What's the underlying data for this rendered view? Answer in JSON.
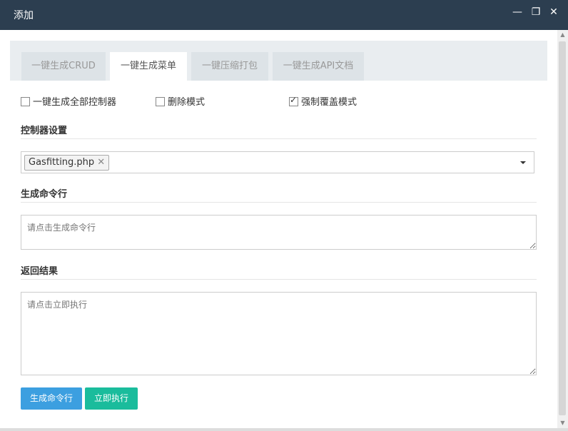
{
  "window": {
    "title": "添加",
    "minimize_glyph": "—",
    "restore_glyph": "❐",
    "close_glyph": "✕"
  },
  "tabs": [
    {
      "label": "一键生成CRUD",
      "active": false
    },
    {
      "label": "一键生成菜单",
      "active": true
    },
    {
      "label": "一键压缩打包",
      "active": false
    },
    {
      "label": "一键生成API文档",
      "active": false
    }
  ],
  "options": {
    "all_controllers": {
      "label": "一键生成全部控制器",
      "checked": false
    },
    "delete_mode": {
      "label": "删除模式",
      "checked": false
    },
    "force_overwrite": {
      "label": "强制覆盖模式",
      "checked": true
    }
  },
  "controller_section": {
    "title": "控制器设置",
    "selected_tag": "Gasfitting.php",
    "remove_glyph": "✕"
  },
  "command_section": {
    "title": "生成命令行",
    "placeholder": "请点击生成命令行"
  },
  "result_section": {
    "title": "返回结果",
    "placeholder": "请点击立即执行"
  },
  "buttons": {
    "generate": "生成命令行",
    "execute": "立即执行"
  },
  "colors": {
    "titlebar": "#2c3e50",
    "primary_button": "#3c9fe0",
    "success_button": "#1abc9c"
  }
}
